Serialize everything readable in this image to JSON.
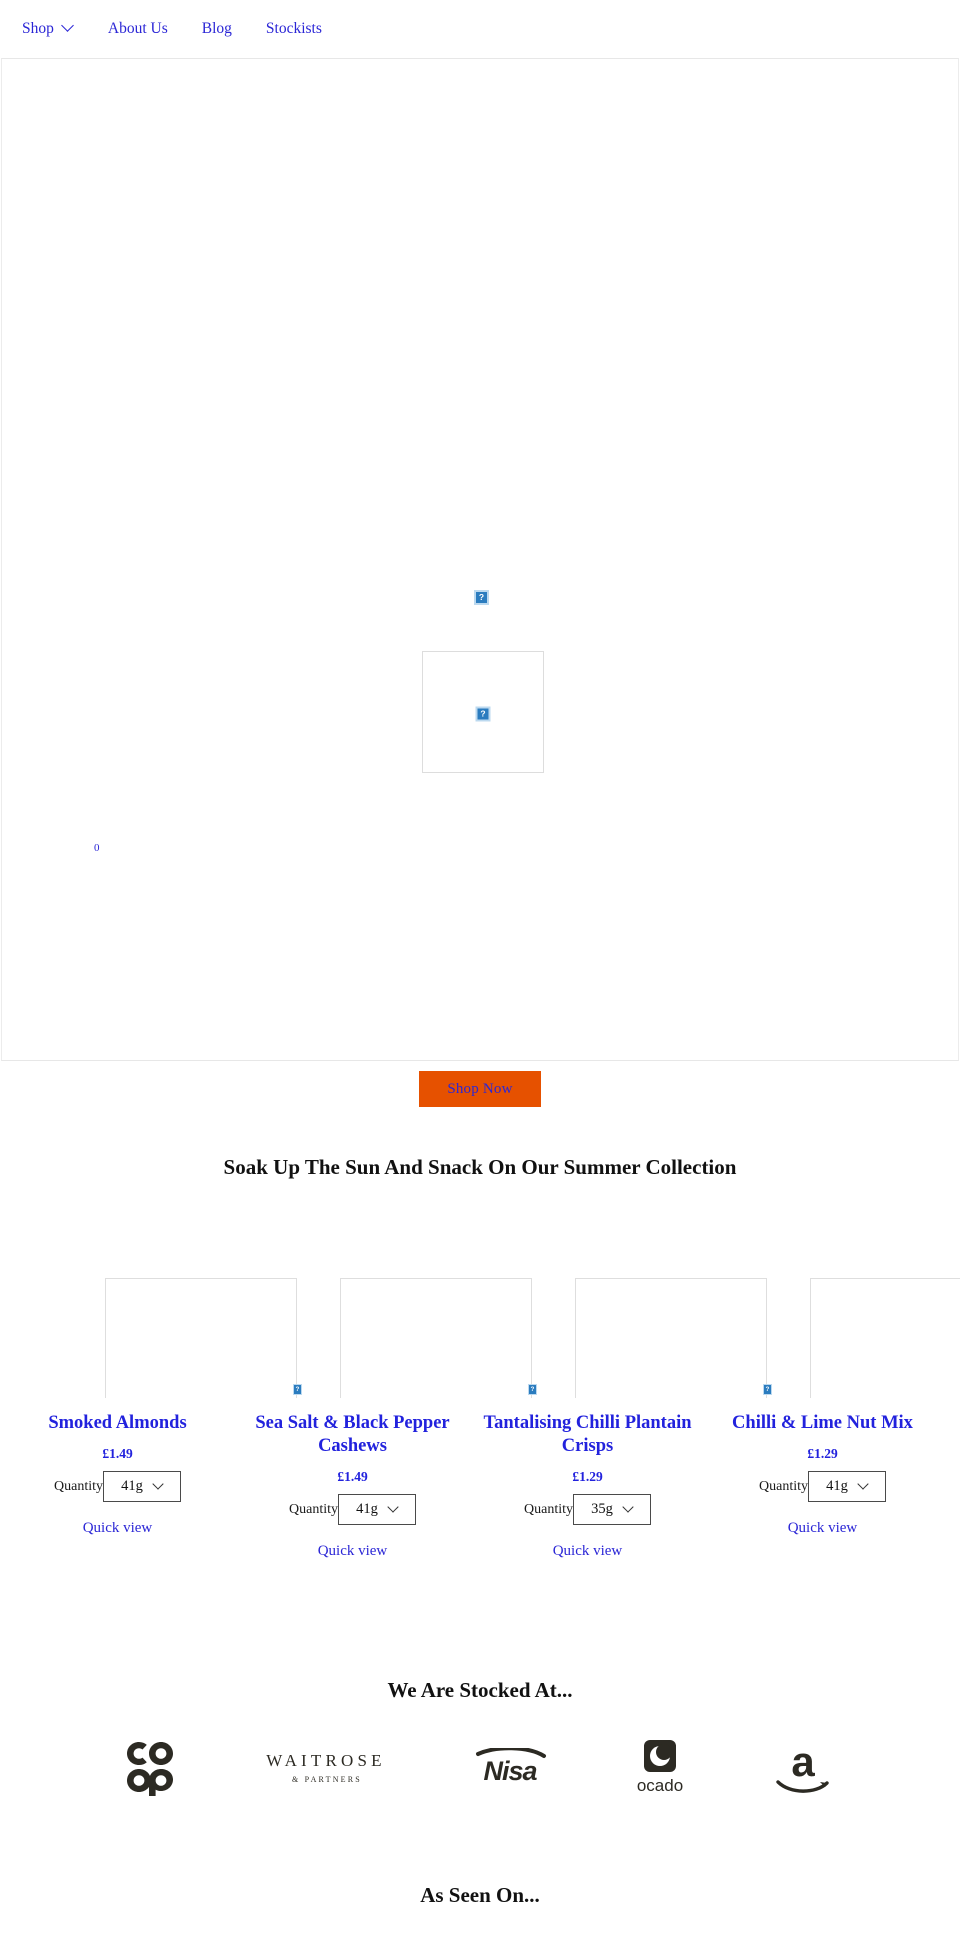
{
  "nav": {
    "items": [
      {
        "label": "Shop",
        "has_caret": true,
        "icon": "chevron-down-icon"
      },
      {
        "label": "About Us",
        "has_caret": false
      },
      {
        "label": "Blog",
        "has_caret": false
      },
      {
        "label": "Stockists",
        "has_caret": false
      }
    ]
  },
  "hero": {
    "image_alt": "broken-image-placeholder",
    "card_image_alt": "broken-image-placeholder",
    "counter": "0",
    "shop_now_label": "Shop Now",
    "button_color": "#e65100",
    "button_text_color": "#2b26d6"
  },
  "summer": {
    "heading": "Soak Up The Sun And Snack On Our Summer Collection"
  },
  "products": [
    {
      "title": "Smoked Almonds",
      "price": "£1.49",
      "quantity_label": "Quantity",
      "quantity_value": "41g",
      "quick_view_label": "Quick view",
      "image_alt": "broken-image-placeholder"
    },
    {
      "title": "Sea Salt & Black Pepper Cashews",
      "price": "£1.49",
      "quantity_label": "Quantity",
      "quantity_value": "41g",
      "quick_view_label": "Quick view",
      "image_alt": "broken-image-placeholder"
    },
    {
      "title": "Tantalising Chilli Plantain Crisps",
      "price": "£1.29",
      "quantity_label": "Quantity",
      "quantity_value": "35g",
      "quick_view_label": "Quick view",
      "image_alt": "broken-image-placeholder"
    },
    {
      "title": "Chilli & Lime Nut Mix",
      "price": "£1.29",
      "quantity_label": "Quantity",
      "quantity_value": "41g",
      "quick_view_label": "Quick view",
      "image_alt": "broken-image-placeholder"
    }
  ],
  "stockists": {
    "heading": "We Are Stocked At...",
    "logos": [
      {
        "name": "co-op-logo",
        "label": "co op"
      },
      {
        "name": "waitrose-logo",
        "label": "WAITROSE",
        "sublabel": "& PARTNERS"
      },
      {
        "name": "nisa-logo",
        "label": "Nisa"
      },
      {
        "name": "ocado-logo",
        "label": "ocado"
      },
      {
        "name": "amazon-logo",
        "label": "a"
      }
    ],
    "logo_color": "#2c2a23"
  },
  "as_seen": {
    "heading": "As Seen On..."
  },
  "colors": {
    "link": "#2b26d6",
    "product_title": "#2222dd",
    "accent_orange": "#e65100",
    "text": "#111111"
  }
}
